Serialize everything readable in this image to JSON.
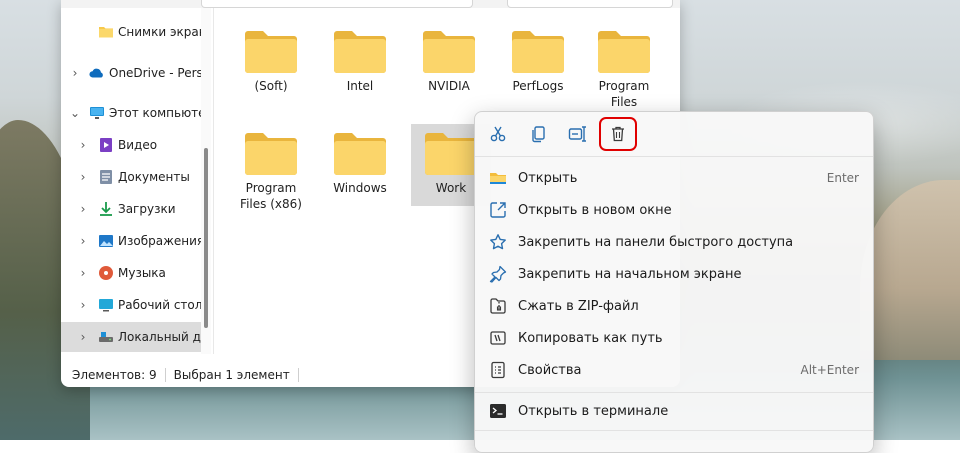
{
  "sidebar": {
    "items": [
      {
        "label": "Снимки экрана",
        "icon": "folder-icon"
      },
      {
        "label": "OneDrive - Perso",
        "icon": "onedrive-cloud-icon"
      },
      {
        "label": "Этот компьютер",
        "icon": "monitor-icon"
      },
      {
        "label": "Видео",
        "icon": "video-icon"
      },
      {
        "label": "Документы",
        "icon": "documents-icon"
      },
      {
        "label": "Загрузки",
        "icon": "download-icon"
      },
      {
        "label": "Изображения",
        "icon": "pictures-icon"
      },
      {
        "label": "Музыка",
        "icon": "music-icon"
      },
      {
        "label": "Рабочий стол",
        "icon": "desktop-icon"
      },
      {
        "label": "Локальный дис",
        "icon": "drive-icon"
      }
    ]
  },
  "files": [
    {
      "name": "(Soft)"
    },
    {
      "name": "Intel"
    },
    {
      "name": "NVIDIA"
    },
    {
      "name": "PerfLogs"
    },
    {
      "name": "Program Files"
    },
    {
      "name": "Program Files (x86)"
    },
    {
      "name": "Windows"
    },
    {
      "name": "Work"
    }
  ],
  "status": {
    "count": "Элементов: 9",
    "selected": "Выбран 1 элемент"
  },
  "context_menu": {
    "toolbar": [
      "cut-icon",
      "copy-icon",
      "rename-icon",
      "delete-icon"
    ],
    "items": [
      {
        "label": "Открыть",
        "shortcut": "Enter",
        "icon": "folder-icon"
      },
      {
        "label": "Открыть в новом окне",
        "shortcut": "",
        "icon": "open-new-window-icon"
      },
      {
        "label": "Закрепить на панели быстрого доступа",
        "shortcut": "",
        "icon": "star-icon"
      },
      {
        "label": "Закрепить на начальном экране",
        "shortcut": "",
        "icon": "pin-icon"
      },
      {
        "label": "Сжать в ZIP-файл",
        "shortcut": "",
        "icon": "zip-icon"
      },
      {
        "label": "Копировать как путь",
        "shortcut": "",
        "icon": "copy-path-icon"
      },
      {
        "label": "Свойства",
        "shortcut": "Alt+Enter",
        "icon": "properties-icon"
      },
      {
        "label": "Открыть в терминале",
        "shortcut": "",
        "icon": "terminal-icon"
      }
    ]
  },
  "colors": {
    "accent": "#0067c0",
    "folder": "#f8c94a",
    "highlight_box": "#e00000"
  }
}
